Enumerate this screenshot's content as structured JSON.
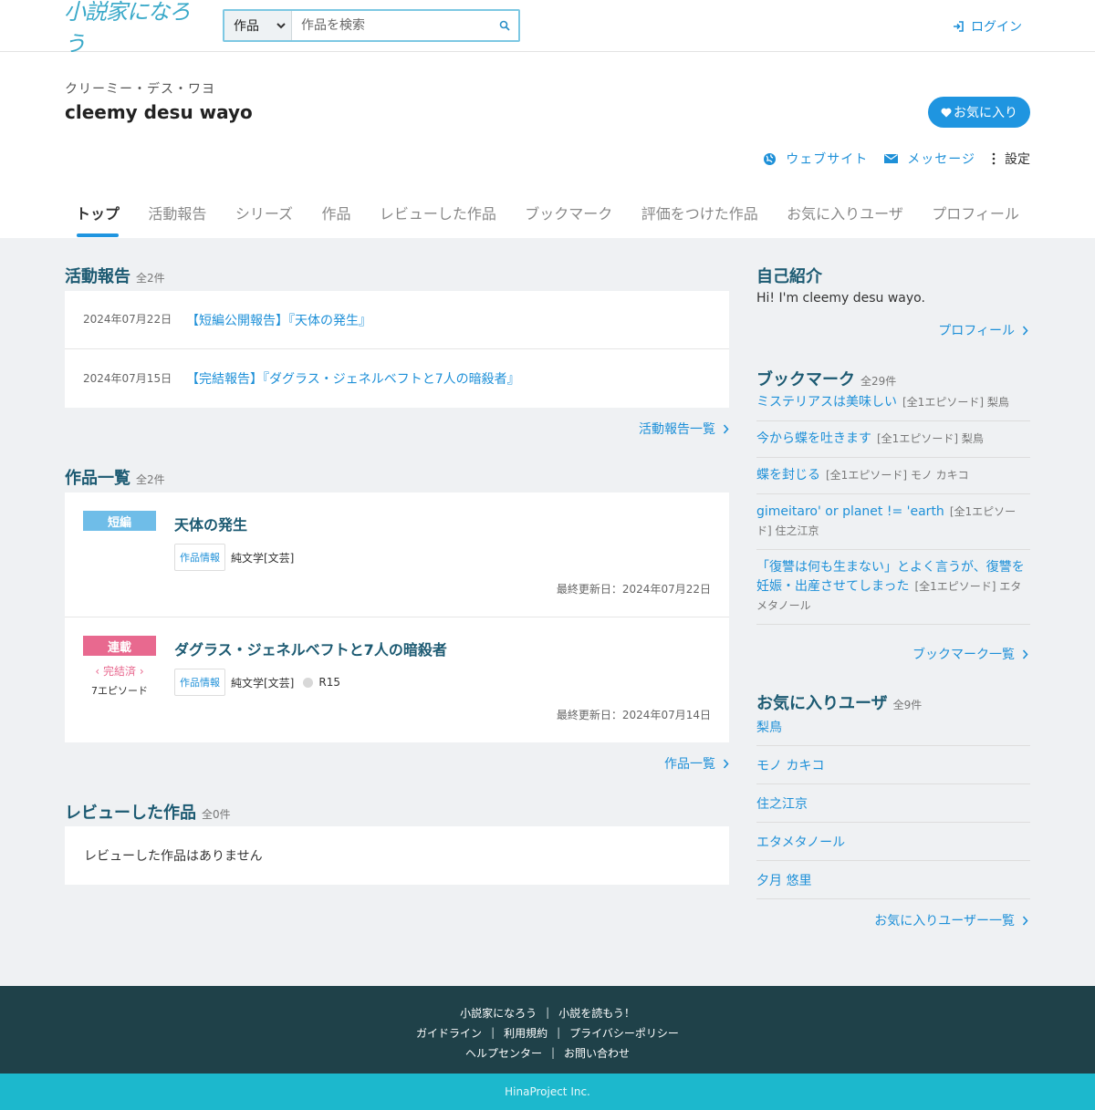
{
  "header": {
    "logo_text": "小説家になろう",
    "search_category": "作品",
    "search_placeholder": "作品を検索",
    "login_label": "ログイン"
  },
  "profile": {
    "kana": "クリーミー・デス・ワヨ",
    "name": "cleemy desu wayo",
    "favorite_button": "お気に入り",
    "website_label": "ウェブサイト",
    "message_label": "メッセージ",
    "settings_label": "設定"
  },
  "tabs": [
    "トップ",
    "活動報告",
    "シリーズ",
    "作品",
    "レビューした作品",
    "ブックマーク",
    "評価をつけた作品",
    "お気に入りユーザ",
    "プロフィール"
  ],
  "activity": {
    "title": "活動報告",
    "count": "全2件",
    "items": [
      {
        "date": "2024年07月22日",
        "title": "【短編公開報告】『天体の発生』"
      },
      {
        "date": "2024年07月15日",
        "title": "【完結報告】『ダグラス・ジェネルベフトと7人の暗殺者』"
      }
    ],
    "more": "活動報告一覧"
  },
  "works": {
    "title": "作品一覧",
    "count": "全2件",
    "items": [
      {
        "type": "短編",
        "title": "天体の発生",
        "info": "作品情報",
        "genre": "純文学[文芸]",
        "updated": "最終更新日：2024年07月22日"
      },
      {
        "type": "連載",
        "status": "完結済",
        "episodes": "7エピソード",
        "title": "ダグラス・ジェネルベフトと7人の暗殺者",
        "info": "作品情報",
        "genre": "純文学[文芸]",
        "rating": "R15",
        "updated": "最終更新日：2024年07月14日"
      }
    ],
    "more": "作品一覧"
  },
  "reviews": {
    "title": "レビューした作品",
    "count": "全0件",
    "empty": "レビューした作品はありません"
  },
  "intro": {
    "title": "自己紹介",
    "text": "Hi! I'm cleemy desu wayo.",
    "more": "プロフィール"
  },
  "bookmarks": {
    "title": "ブックマーク",
    "count": "全29件",
    "items": [
      {
        "title": "ミステリアスは美味しい",
        "meta": "[全1エピソード] 梨鳥"
      },
      {
        "title": "今から蝶を吐きます",
        "meta": "[全1エピソード] 梨鳥"
      },
      {
        "title": "蝶を封じる",
        "meta": "[全1エピソード] モノ カキコ"
      },
      {
        "title": "gimeitaro' or planet != 'earth",
        "meta": "[全1エピソード] 住之江京"
      },
      {
        "title": "「復讐は何も生まない」とよく言うが、復讐を妊娠・出産させてしまった",
        "meta": "[全1エピソード] エタメタノール"
      }
    ],
    "more": "ブックマーク一覧"
  },
  "fav_users": {
    "title": "お気に入りユーザ",
    "count": "全9件",
    "items": [
      "梨鳥",
      "モノ カキコ",
      "住之江京",
      "エタメタノール",
      "夕月 悠里"
    ],
    "more": "お気に入りユーザー一覧"
  },
  "footer": {
    "row1": [
      "小説家になろう",
      "小説を読もう！"
    ],
    "row2": [
      "ガイドライン",
      "利用規約",
      "プライバシーポリシー"
    ],
    "row3": [
      "ヘルプセンター",
      "お問い合わせ"
    ],
    "copyright": "HinaProject Inc."
  },
  "colors": {
    "accent": "#1f95e0",
    "short_badge": "#6fbde8",
    "serial_badge": "#e8698f",
    "footer_bg": "#1f4149",
    "copyright_bg": "#1cb8cd"
  }
}
